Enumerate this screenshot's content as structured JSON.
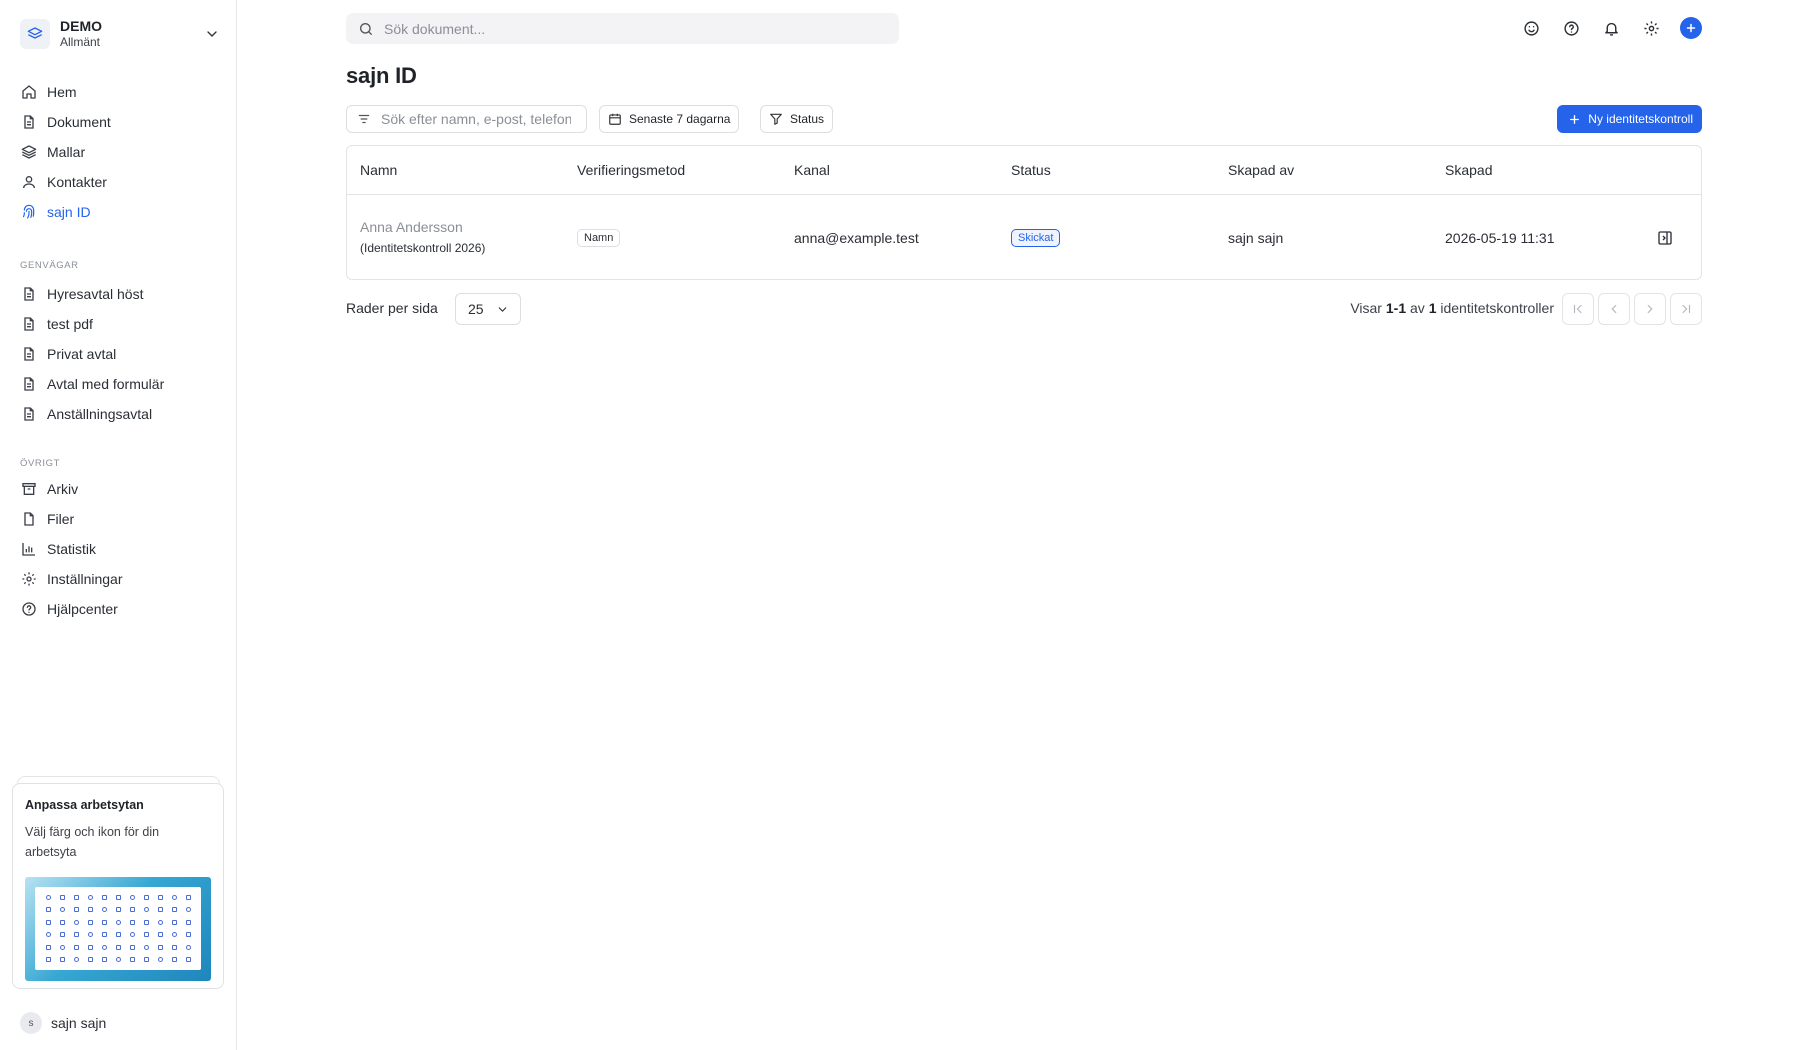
{
  "workspace": {
    "name": "DEMO",
    "subtitle": "Allmänt",
    "icon": "layers-icon"
  },
  "nav": {
    "items": [
      {
        "label": "Hem",
        "icon": "home-icon"
      },
      {
        "label": "Dokument",
        "icon": "document-icon"
      },
      {
        "label": "Mallar",
        "icon": "layers-icon"
      },
      {
        "label": "Kontakter",
        "icon": "user-icon"
      },
      {
        "label": "sajn ID",
        "icon": "fingerprint-icon",
        "active": true
      }
    ]
  },
  "shortcuts": {
    "label": "GENVÄGAR",
    "items": [
      {
        "label": "Hyresavtal höst",
        "icon": "document-icon"
      },
      {
        "label": "test pdf",
        "icon": "document-icon"
      },
      {
        "label": "Privat avtal",
        "icon": "document-icon"
      },
      {
        "label": "Avtal med formulär",
        "icon": "document-icon"
      },
      {
        "label": "Anställningsavtal",
        "icon": "document-icon"
      }
    ]
  },
  "other": {
    "label": "ÖVRIGT",
    "items": [
      {
        "label": "Arkiv",
        "icon": "archive-icon"
      },
      {
        "label": "Filer",
        "icon": "file-icon"
      },
      {
        "label": "Statistik",
        "icon": "chart-icon"
      },
      {
        "label": "Inställningar",
        "icon": "gear-icon"
      },
      {
        "label": "Hjälpcenter",
        "icon": "help-icon"
      }
    ]
  },
  "promo": {
    "title": "Anpassa arbetsytan",
    "text": "Välj färg och ikon för din arbetsyta"
  },
  "user": {
    "initial": "s",
    "name": "sajn sajn"
  },
  "topbar": {
    "search_placeholder": "Sök dokument...",
    "icons": [
      "smiley-icon",
      "help-icon",
      "bell-icon",
      "gear-icon",
      "plus-circle-icon"
    ]
  },
  "page": {
    "title": "sajn ID"
  },
  "filters": {
    "search_placeholder": "Sök efter namn, e-post, telefon",
    "date_label": "Senaste 7 dagarna",
    "status_label": "Status",
    "new_button": "Ny identitetskontroll"
  },
  "table": {
    "headers": [
      "Namn",
      "Verifieringsmetod",
      "Kanal",
      "Status",
      "Skapad av",
      "Skapad"
    ],
    "rows": [
      {
        "name": "Anna Andersson",
        "name_sub": "(Identitetskontroll 2026)",
        "method": "Namn",
        "channel": "anna@example.test",
        "status": "Skickat",
        "created_by": "sajn sajn",
        "created": "2026-05-19 11:31"
      }
    ]
  },
  "pagination": {
    "rows_per_page_label": "Rader per sida",
    "rows_per_page": "25",
    "showing_prefix": "Visar",
    "showing_range": "1-1",
    "showing_of": "av",
    "showing_total": "1",
    "showing_suffix": "identitetskontroller"
  },
  "colors": {
    "accent": "#2563eb",
    "border": "#e3e4e8",
    "muted": "#8b8f96"
  }
}
